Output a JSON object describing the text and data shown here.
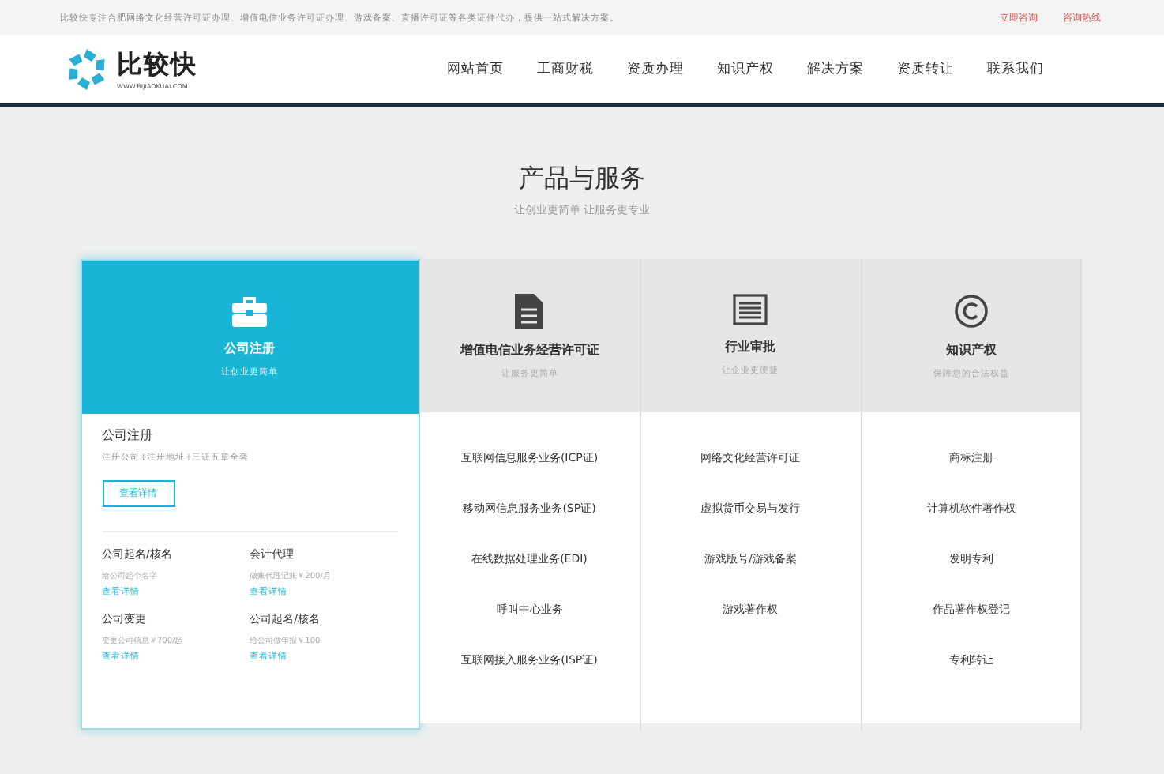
{
  "top_bar": {
    "notice": "比较快专注合肥网络文化经营许可证办理、增值电信业务许可证办理、游戏备案、直播许可证等各类证件代办，提供一站式解决方案。",
    "links": [
      "立即咨询",
      "咨询热线"
    ]
  },
  "header": {
    "logo_name": "比较快",
    "logo_url": "WWW.BIJIAOKUAI.COM",
    "nav": [
      {
        "label": "网站首页",
        "selected": false
      },
      {
        "label": "工商财税",
        "selected": false
      },
      {
        "label": "资质办理",
        "selected": false
      },
      {
        "label": "知识产权",
        "selected": false
      },
      {
        "label": "解决方案",
        "selected": false
      },
      {
        "label": "资质转让",
        "selected": false
      },
      {
        "label": "联系我们",
        "selected": false
      }
    ]
  },
  "section": {
    "title": "产品与服务",
    "subtitle": "让创业更简单 让服务更专业"
  },
  "categories": [
    {
      "kind": "briefcase",
      "title": "公司注册",
      "subtitle": "让创业更简单",
      "selected": true,
      "detail": {
        "title": "公司注册",
        "description": "注册公司+注册地址+三证五章全套",
        "button": "查看详情",
        "services": [
          {
            "name": "公司起名/核名",
            "description": "给公司起个名字",
            "link": "查看详情"
          },
          {
            "name": "会计代理",
            "description": "做账代理记账￥200/月",
            "link": "查看详情"
          },
          {
            "name": "公司变更",
            "description": "变更公司信息￥700/起",
            "link": "查看详情"
          },
          {
            "name": "公司起名/核名",
            "description": "给公司做年报￥100",
            "link": "查看详情"
          }
        ]
      }
    },
    {
      "kind": "document",
      "title": "增值电信业务经营许可证",
      "subtitle": "让服务更简单",
      "selected": false,
      "items": [
        "互联网信息服务业务(ICP证)",
        "移动网信息服务业务(SP证)",
        "在线数据处理业务(EDI)",
        "呼叫中心业务",
        "互联网接入服务业务(ISP证)"
      ]
    },
    {
      "kind": "newspaper",
      "title": "行业审批",
      "subtitle": "让企业更便捷",
      "selected": false,
      "items": [
        "网络文化经营许可证",
        "虚拟货币交易与发行",
        "游戏版号/游戏备案",
        "游戏著作权"
      ]
    },
    {
      "kind": "copyright",
      "title": "知识产权",
      "subtitle": "保障您的合法权益",
      "selected": false,
      "items": [
        "商标注册",
        "计算机软件著作权",
        "发明专利",
        "作品著作权登记",
        "专利转让"
      ]
    }
  ]
}
